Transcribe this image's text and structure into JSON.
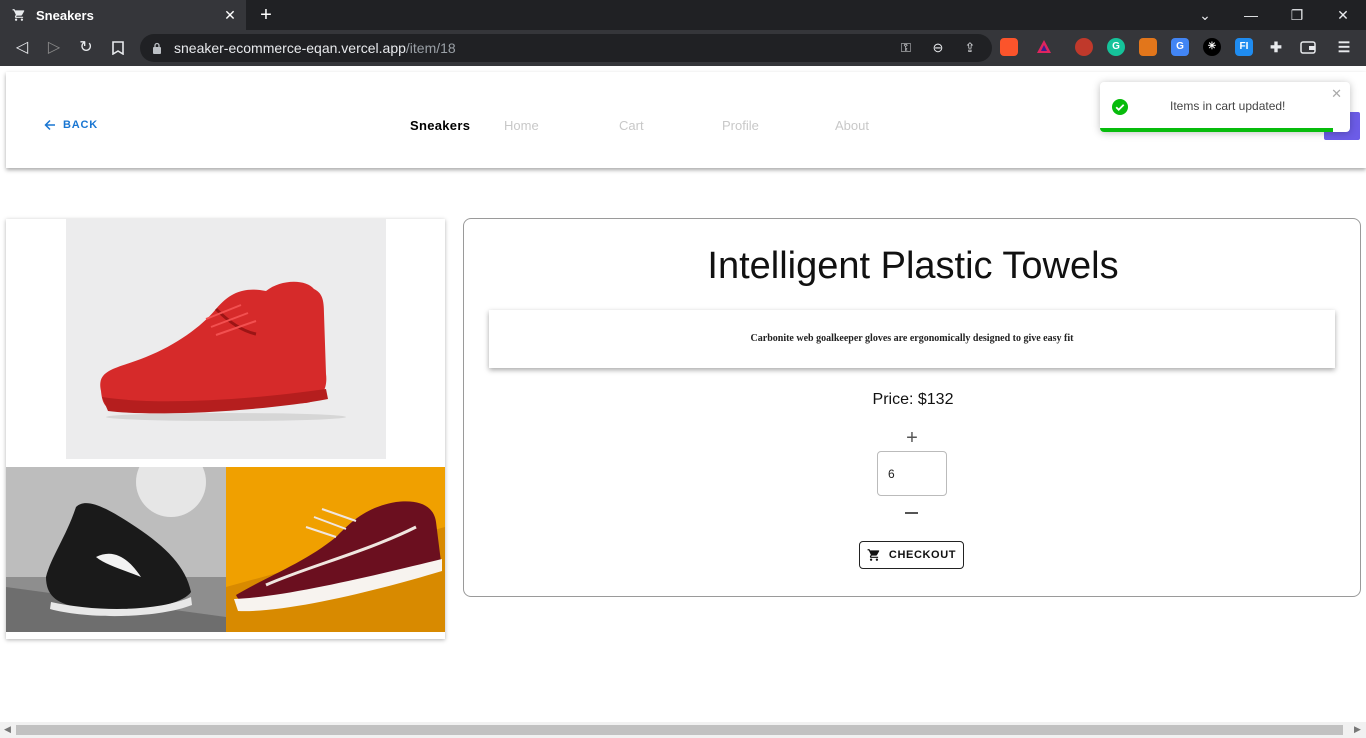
{
  "browser": {
    "tab_title": "Sneakers",
    "tab_close": "✕",
    "new_tab": "+",
    "url_host": "sneaker-ecommerce-eqan.vercel.app",
    "url_path": "/item/18",
    "extensions": [
      {
        "name": "brave-icon",
        "color": "#fb542b",
        "glyph": ""
      },
      {
        "name": "triangle-icon",
        "color": "#e0245e",
        "glyph": ""
      },
      {
        "name": "no-script-icon",
        "color": "#c0392b",
        "glyph": ""
      },
      {
        "name": "grammarly-icon",
        "color": "#15c39a",
        "glyph": "G"
      },
      {
        "name": "metamask-icon",
        "color": "#e2761b",
        "glyph": ""
      },
      {
        "name": "translate-icon",
        "color": "#4285f4",
        "glyph": "G"
      },
      {
        "name": "starknet-icon",
        "color": "#000000",
        "glyph": "✳"
      },
      {
        "name": "fi-icon",
        "color": "#1f8cf0",
        "glyph": "FI"
      }
    ]
  },
  "header": {
    "back_label": "BACK",
    "brand": "Sneakers",
    "nav": [
      "Home",
      "Cart",
      "Profile",
      "About"
    ]
  },
  "toast": {
    "message": "Items in cart updated!",
    "close": "✕",
    "progress": 0.93,
    "color": "#07bc0c"
  },
  "product": {
    "title": "Intelligent Plastic Towels",
    "description": "Carbonite web goalkeeper gloves are ergonomically designed to give easy fit",
    "price_label": "Price: $132",
    "quantity": "6",
    "plus": "+",
    "checkout_label": "CHECKOUT"
  }
}
